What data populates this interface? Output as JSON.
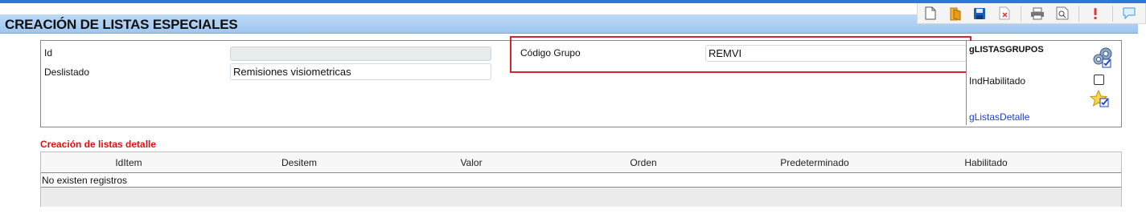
{
  "page": {
    "title": "CREACIÓN DE LISTAS ESPECIALES"
  },
  "toolbar": {
    "icons": [
      "new-document-icon",
      "open-folder-icon",
      "save-icon",
      "delete-icon",
      "print-icon",
      "preview-icon",
      "alert-icon",
      "comment-icon"
    ]
  },
  "form": {
    "id_label": "Id",
    "id_value": "",
    "deslistado_label": "Deslistado",
    "deslistado_value": "Remisiones visiometricas",
    "codigo_grupo_label": "Código Grupo",
    "codigo_grupo_value": "REMVI"
  },
  "side_panel": {
    "title": "gLISTASGRUPOS",
    "ind_habilitado_label": "IndHabilitado",
    "ind_habilitado_checked": false,
    "detail_link": "gListasDetalle"
  },
  "detail_section": {
    "title": "Creación de listas detalle",
    "columns": [
      "IdItem",
      "Desitem",
      "Valor",
      "Orden",
      "Predeterminado",
      "Habilitado"
    ],
    "empty_message": "No existen registros"
  },
  "colors": {
    "topbar": "#2b78d6",
    "title_bg": "#a9cdf1",
    "highlight": "#d9232d",
    "section_title": "#e01010",
    "link": "#1f3fc4"
  }
}
